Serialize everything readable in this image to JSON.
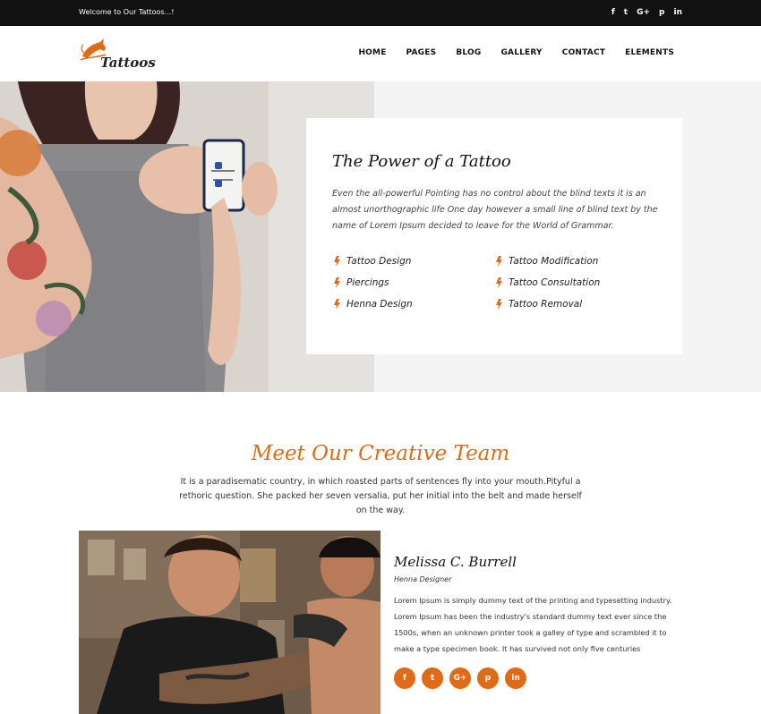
{
  "topbar": {
    "welcome": "Welcome to Our Tattoos...!",
    "social": [
      {
        "icon": "facebook-icon",
        "glyph": "f"
      },
      {
        "icon": "twitter-icon",
        "glyph": "t"
      },
      {
        "icon": "google-plus-icon",
        "glyph": "G+"
      },
      {
        "icon": "pinterest-icon",
        "glyph": "p"
      },
      {
        "icon": "linkedin-icon",
        "glyph": "in"
      }
    ]
  },
  "header": {
    "logo_text": "Tattoos",
    "nav": [
      "HOME",
      "PAGES",
      "BLOG",
      "GALLERY",
      "CONTACT",
      "ELEMENTS"
    ]
  },
  "hero": {
    "title": "The Power of a Tattoo",
    "text": "Even the all-powerful Pointing has no control about the blind texts it is an almost unorthographic life One day however a small line of blind text by the name of Lorem Ipsum decided to leave for the World of Grammar.",
    "services": [
      "Tattoo Design",
      "Tattoo Modification",
      "Piercings",
      "Tattoo Consultation",
      "Henna Design",
      "Tattoo Removal"
    ]
  },
  "team": {
    "title": "Meet Our Creative Team",
    "intro": "It is a paradisematic country, in which roasted parts of sentences fly into your mouth.Pityful a rethoric question. She packed her seven versalia, put her initial into the belt and made herself on the way.",
    "member": {
      "name": "Melissa C. Burrell",
      "role": "Henna Designer",
      "bio": "Lorem Ipsum is simply dummy text of the printing and typesetting industry. Lorem Ipsum has been the industry's standard dummy text ever since the 1500s, when an unknown printer took a galley of type and scrambled it to make a type specimen book. It has survived not only five centuries",
      "social": [
        {
          "icon": "facebook-icon",
          "glyph": "f"
        },
        {
          "icon": "twitter-icon",
          "glyph": "t"
        },
        {
          "icon": "google-plus-icon",
          "glyph": "G+"
        },
        {
          "icon": "pinterest-icon",
          "glyph": "p"
        },
        {
          "icon": "linkedin-icon",
          "glyph": "in"
        }
      ]
    }
  },
  "colors": {
    "accent": "#e06a15",
    "topbar": "#111111",
    "hero_bg": "#f4f4f4"
  }
}
